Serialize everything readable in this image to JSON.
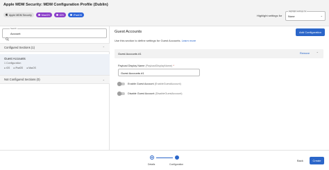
{
  "header": {
    "title": "Apple MDM Security: MDM Configuration Profile (Dublin)",
    "chips": [
      {
        "label": "Apple MDM Security",
        "style": "gray",
        "icon": "apple-icon"
      },
      {
        "label": "MacOS",
        "style": "purple",
        "icon": "dot-icon"
      },
      {
        "label": "iOS",
        "style": "purple",
        "icon": "dot-icon"
      },
      {
        "label": "iPadOS",
        "style": "blue",
        "icon": "dot-icon"
      }
    ],
    "highlight_label": "Highlight settings for",
    "highlight_select": {
      "float_label": "Highlight settings for",
      "value": "None"
    }
  },
  "sidebar": {
    "search": {
      "float_label": "Search",
      "value": "Account"
    },
    "configured_header": "Configured Sections (1)",
    "item": {
      "name": "Guest Accounts",
      "sub": "1 Configuration",
      "platforms": [
        "iOS",
        "iPadOS",
        "MacOS"
      ]
    },
    "not_configured_header": "Not Configured Sections (0)"
  },
  "main": {
    "title": "Guest Accounts",
    "description": "Use this section to define settings for Guest Accounts.",
    "learn_more": "Learn more",
    "add_button": "Add Configuration",
    "card": {
      "title": "Guest Accounts #1",
      "remove": "Remove",
      "field_label": "Payload Display Name",
      "field_hint": "(PayloadDisplayName)",
      "field_required": "*",
      "field_value": "Guest Accounts #1",
      "toggles": [
        {
          "label": "Enable Guest Account",
          "hint": "(EnableGuestAccount)",
          "on": false
        },
        {
          "label": "Disable Guest Account",
          "hint": "(DisableGuestAccount)",
          "on": false
        }
      ]
    }
  },
  "footer": {
    "steps": [
      "Details",
      "Configuration"
    ],
    "back": "Back",
    "create": "Create"
  },
  "colors": {
    "accent": "#2b66c9",
    "purple": "#8b3fc9",
    "link": "#1f5fc8"
  }
}
